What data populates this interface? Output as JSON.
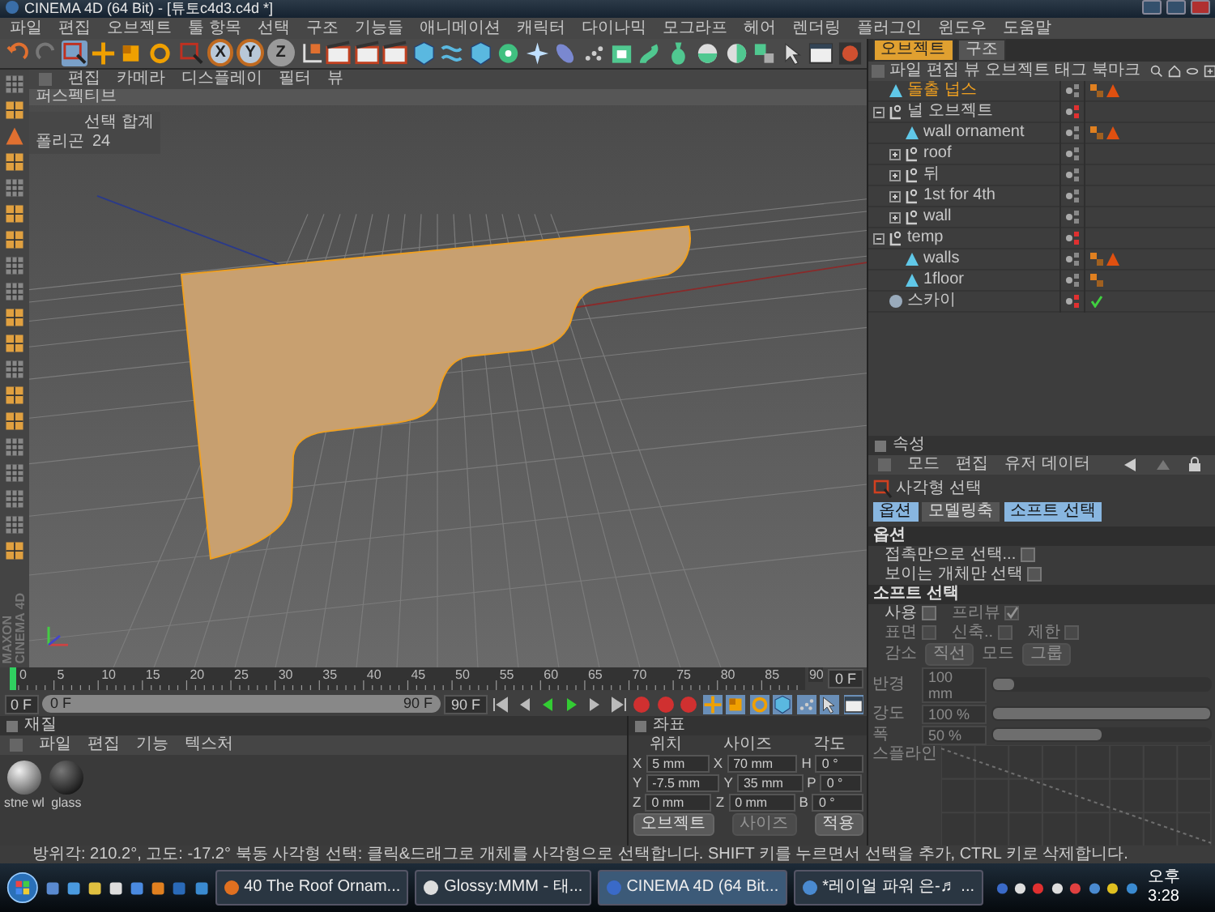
{
  "window": {
    "title": "CINEMA 4D (64 Bit) - [튜토c4d3.c4d *]"
  },
  "menu": [
    "파일",
    "편집",
    "오브젝트",
    "툴 항목",
    "선택",
    "구조",
    "기능들",
    "애니메이션",
    "캐릭터",
    "다이나믹",
    "모그라프",
    "헤어",
    "렌더링",
    "플러그인",
    "윈도우",
    "도움말"
  ],
  "toolbar": {
    "axis_buttons": [
      {
        "label": "X",
        "selected": true
      },
      {
        "label": "Y",
        "selected": true
      },
      {
        "label": "Z",
        "selected": false
      }
    ]
  },
  "viewport": {
    "menu": [
      "편집",
      "카메라",
      "디스플레이",
      "필터",
      "뷰"
    ],
    "view_name": "퍼스펙티브",
    "hud": {
      "title": "선택 합계",
      "label": "폴리곤",
      "value": "24"
    }
  },
  "object_manager": {
    "tabs": [
      {
        "label": "오브젝트",
        "selected": true
      },
      {
        "label": "구조",
        "selected": false
      }
    ],
    "menu": [
      "파일",
      "편집",
      "뷰",
      "오브젝트",
      "태그",
      "북마크"
    ],
    "objects": [
      {
        "name": "돌출 넙스",
        "kind": "extrude",
        "selected": true,
        "hidden": false,
        "check": false,
        "texture_tag": true,
        "phong_tag": true
      },
      {
        "name": "널 오브젝트",
        "kind": "null",
        "selected": false,
        "hidden": true,
        "check": false,
        "texture_tag": false,
        "phong_tag": false,
        "expanded": true,
        "children": [
          {
            "name": "wall ornament",
            "kind": "polygon",
            "selected": false,
            "hidden": false,
            "check": false,
            "texture_tag": true,
            "phong_tag": true
          },
          {
            "name": "roof",
            "kind": "null",
            "selected": false,
            "hidden": false,
            "check": false,
            "texture_tag": false,
            "phong_tag": false,
            "expanded": false
          },
          {
            "name": "뒤",
            "kind": "null",
            "selected": false,
            "hidden": false,
            "check": false,
            "texture_tag": false,
            "phong_tag": false,
            "expanded": false
          },
          {
            "name": "1st for 4th",
            "kind": "null",
            "selected": false,
            "hidden": false,
            "check": false,
            "texture_tag": false,
            "phong_tag": false,
            "expanded": false
          },
          {
            "name": "wall",
            "kind": "null",
            "selected": false,
            "hidden": false,
            "check": false,
            "texture_tag": false,
            "phong_tag": false,
            "expanded": false
          }
        ]
      },
      {
        "name": "temp",
        "kind": "null",
        "selected": false,
        "hidden": true,
        "check": false,
        "texture_tag": false,
        "phong_tag": false,
        "expanded": true,
        "children": [
          {
            "name": "walls",
            "kind": "polygon",
            "selected": false,
            "hidden": false,
            "check": false,
            "texture_tag": true,
            "phong_tag": true
          },
          {
            "name": "1floor",
            "kind": "polygon",
            "selected": false,
            "hidden": false,
            "check": false,
            "texture_tag": true,
            "phong_tag": false
          }
        ]
      },
      {
        "name": "스카이",
        "kind": "sky",
        "selected": false,
        "hidden": true,
        "check": true,
        "texture_tag": false,
        "phong_tag": false
      }
    ]
  },
  "attributes": {
    "title": "속성",
    "menu": [
      "모드",
      "편집",
      "유저 데이터"
    ],
    "tool": "사각형 선택",
    "tabs": [
      {
        "label": "옵션",
        "selected": true
      },
      {
        "label": "모델링축",
        "selected": false
      },
      {
        "label": "소프트 선택",
        "selected": true
      }
    ],
    "options": {
      "title": "옵션",
      "checks": [
        {
          "label": "접촉만으로 선택...",
          "checked": false
        },
        {
          "label": "보이는 개체만 선택",
          "checked": false
        }
      ]
    },
    "soft_selection": {
      "title": "소프트 선택",
      "disabled": true,
      "check_rows": [
        [
          {
            "label": "사용",
            "checked": false
          },
          {
            "label": "프리뷰",
            "checked": true
          }
        ],
        [
          {
            "label": "표면",
            "checked": false
          },
          {
            "label": "신축..",
            "checked": false
          },
          {
            "label": "제한",
            "checked": false
          }
        ]
      ],
      "dropdowns": [
        {
          "label": "감소",
          "value": "직선"
        },
        {
          "label": "모드",
          "value": "그룹"
        }
      ],
      "sliders": [
        {
          "label": "반경",
          "value": "100 mm",
          "level": 0.1
        },
        {
          "label": "강도",
          "value": "100 %",
          "level": 1
        },
        {
          "label": "폭",
          "value": "50 %",
          "level": 0.5
        }
      ],
      "spline_label": "스플라인"
    }
  },
  "timeline": {
    "ticks": [
      "0",
      "5",
      "10",
      "15",
      "20",
      "25",
      "30",
      "35",
      "40",
      "45",
      "50",
      "55",
      "60",
      "65",
      "70",
      "75",
      "80",
      "85",
      "90"
    ],
    "current_frame": "0 F",
    "start_field": "0 F",
    "range": {
      "start": "0 F",
      "end": "90 F",
      "level": 1
    },
    "end_field": "90 F"
  },
  "materials": {
    "title": "재질",
    "menu": [
      "파일",
      "편집",
      "기능",
      "텍스처"
    ],
    "items": [
      {
        "name": "stne wl",
        "kind": "light"
      },
      {
        "name": "glass",
        "kind": "dark"
      }
    ]
  },
  "coordinates": {
    "title": "좌표",
    "headers": [
      "위치",
      "사이즈",
      "각도"
    ],
    "rows": [
      {
        "axes": [
          "X",
          "X",
          "H"
        ],
        "values": [
          "5 mm",
          "70 mm",
          "0 °"
        ]
      },
      {
        "axes": [
          "Y",
          "Y",
          "P"
        ],
        "values": [
          "-7.5 mm",
          "35 mm",
          "0 °"
        ]
      },
      {
        "axes": [
          "Z",
          "Z",
          "B"
        ],
        "values": [
          "0 mm",
          "0 mm",
          "0 °"
        ]
      }
    ],
    "mode": "오브젝트",
    "size_mode": "사이즈",
    "apply": "적용"
  },
  "logo": [
    "MAXON",
    "CINEMA 4D"
  ],
  "status_bar": "방위각: 210.2°, 고도: -17.2° 북동  사각형 선택: 클릭&드래그로 개체를 사각형으로 선택합니다. SHIFT 키를 누르면서 선택을 추가, CTRL 키로 삭제합니다.",
  "taskbar": {
    "tasks": [
      {
        "label": "40 The Roof Ornam...",
        "selected": false
      },
      {
        "label": "Glossy:MMM - 태...",
        "selected": false
      },
      {
        "label": "CINEMA 4D (64 Bit...",
        "selected": true
      },
      {
        "label": "*레이얼 파워 은-♬ ...",
        "selected": false
      }
    ],
    "clock": "오후 3:28"
  }
}
